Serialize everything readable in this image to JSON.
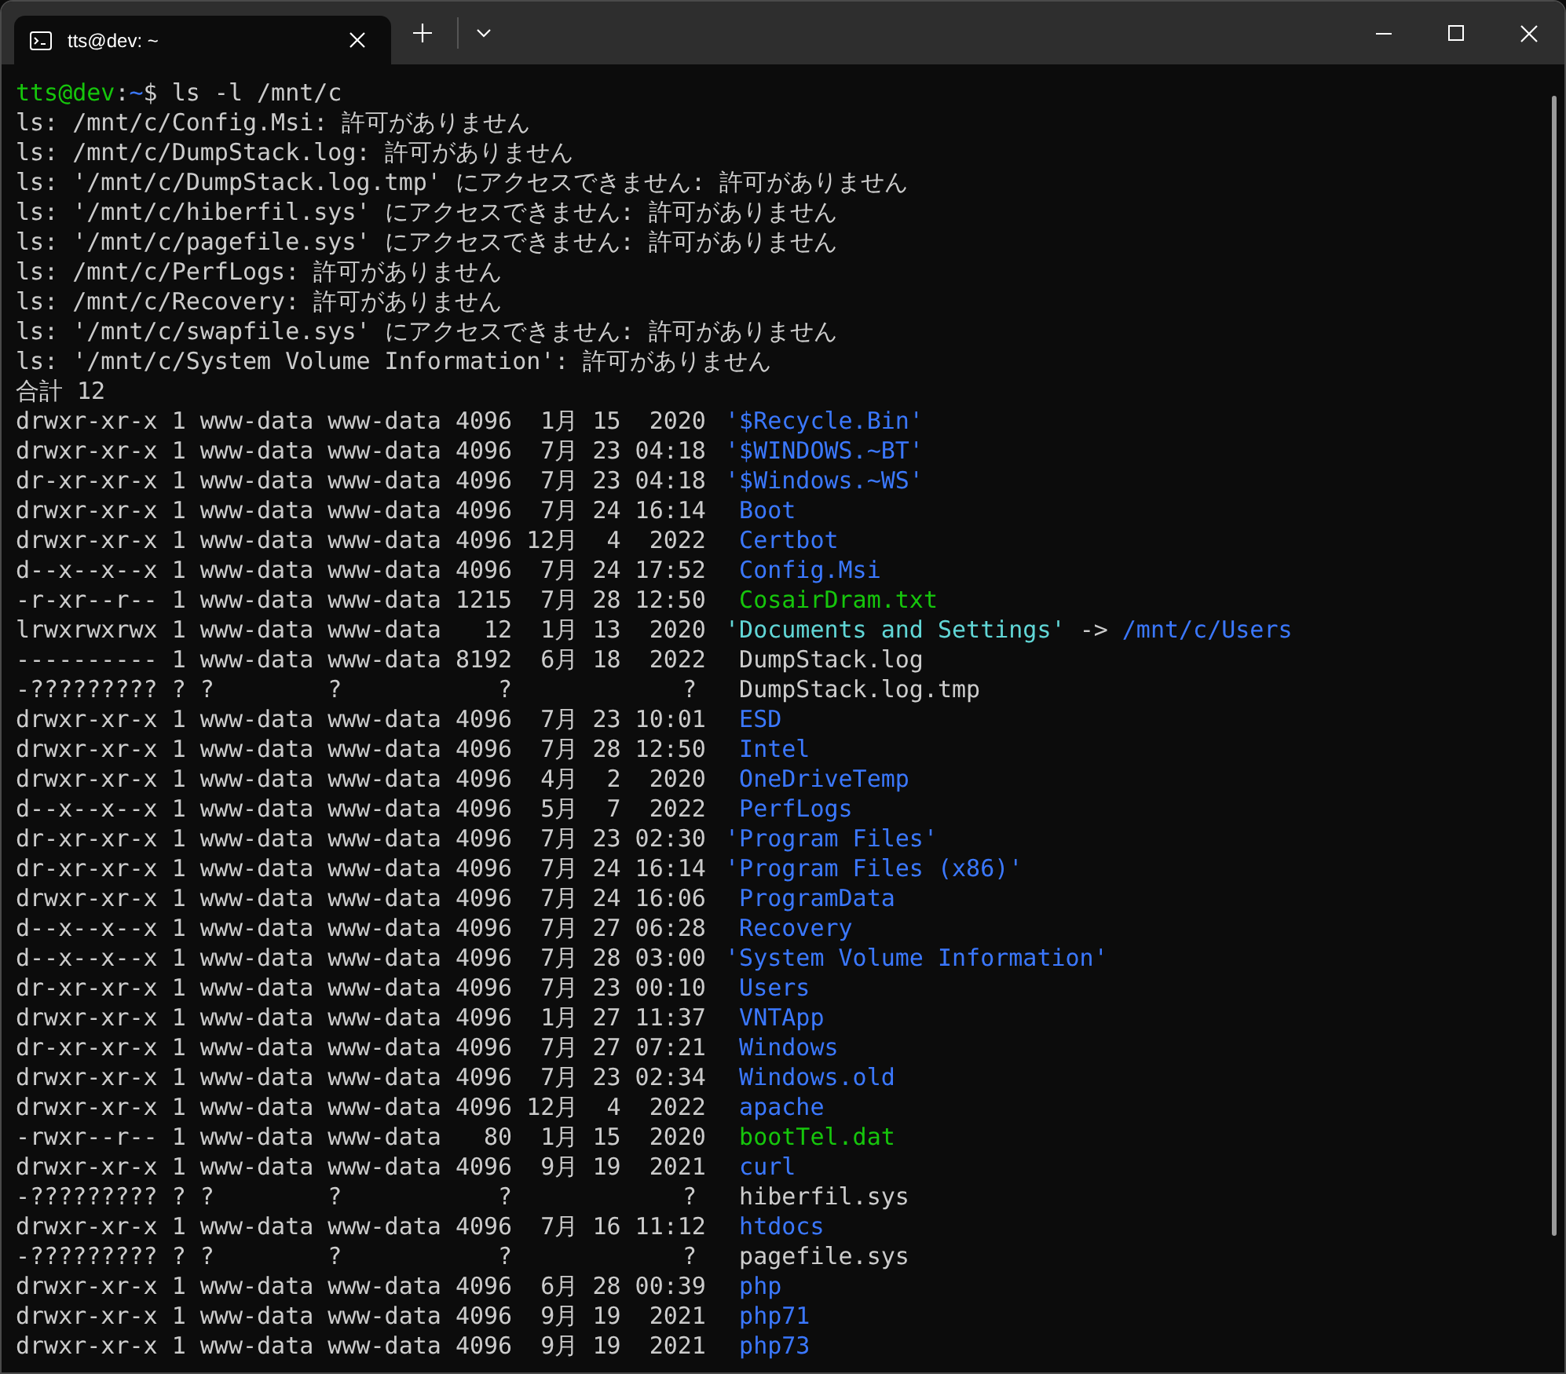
{
  "window": {
    "tab_title": "tts@dev: ~"
  },
  "prompt": {
    "user": "tts@dev",
    "separator": ":",
    "path": "~",
    "symbol": "$",
    "command": "ls -l /mnt/c"
  },
  "errors": [
    "ls: /mnt/c/Config.Msi: 許可がありません",
    "ls: /mnt/c/DumpStack.log: 許可がありません",
    "ls: '/mnt/c/DumpStack.log.tmp' にアクセスできません: 許可がありません",
    "ls: '/mnt/c/hiberfil.sys' にアクセスできません: 許可がありません",
    "ls: '/mnt/c/pagefile.sys' にアクセスできません: 許可がありません",
    "ls: /mnt/c/PerfLogs: 許可がありません",
    "ls: /mnt/c/Recovery: 許可がありません",
    "ls: '/mnt/c/swapfile.sys' にアクセスできません: 許可がありません",
    "ls: '/mnt/c/System Volume Information': 許可がありません"
  ],
  "total": "合計 12",
  "entries": [
    {
      "meta": "drwxr-xr-x 1 www-data www-data 4096  1月 15  2020",
      "name": "'$Recycle.Bin'",
      "kind": "dir",
      "quoted": true
    },
    {
      "meta": "drwxr-xr-x 1 www-data www-data 4096  7月 23 04:18",
      "name": "'$WINDOWS.~BT'",
      "kind": "dir",
      "quoted": true
    },
    {
      "meta": "dr-xr-xr-x 1 www-data www-data 4096  7月 23 04:18",
      "name": "'$Windows.~WS'",
      "kind": "dir",
      "quoted": true
    },
    {
      "meta": "drwxr-xr-x 1 www-data www-data 4096  7月 24 16:14",
      "name": "Boot",
      "kind": "dir",
      "quoted": false
    },
    {
      "meta": "drwxr-xr-x 1 www-data www-data 4096 12月  4  2022",
      "name": "Certbot",
      "kind": "dir",
      "quoted": false
    },
    {
      "meta": "d--x--x--x 1 www-data www-data 4096  7月 24 17:52",
      "name": "Config.Msi",
      "kind": "dir",
      "quoted": false
    },
    {
      "meta": "-r-xr--r-- 1 www-data www-data 1215  7月 28 12:50",
      "name": "CosairDram.txt",
      "kind": "exec",
      "quoted": false
    },
    {
      "meta": "lrwxrwxrwx 1 www-data www-data   12  1月 13  2020",
      "name": "'Documents and Settings'",
      "kind": "link",
      "quoted": true,
      "arrow": "->",
      "target": "/mnt/c/Users"
    },
    {
      "meta": "---------- 1 www-data www-data 8192  6月 18  2022",
      "name": "DumpStack.log",
      "kind": "file",
      "quoted": false
    },
    {
      "meta": "-????????? ? ?        ?           ?            ?",
      "name": "DumpStack.log.tmp",
      "kind": "file",
      "quoted": false
    },
    {
      "meta": "drwxr-xr-x 1 www-data www-data 4096  7月 23 10:01",
      "name": "ESD",
      "kind": "dir",
      "quoted": false
    },
    {
      "meta": "drwxr-xr-x 1 www-data www-data 4096  7月 28 12:50",
      "name": "Intel",
      "kind": "dir",
      "quoted": false
    },
    {
      "meta": "drwxr-xr-x 1 www-data www-data 4096  4月  2  2020",
      "name": "OneDriveTemp",
      "kind": "dir",
      "quoted": false
    },
    {
      "meta": "d--x--x--x 1 www-data www-data 4096  5月  7  2022",
      "name": "PerfLogs",
      "kind": "dir",
      "quoted": false
    },
    {
      "meta": "dr-xr-xr-x 1 www-data www-data 4096  7月 23 02:30",
      "name": "'Program Files'",
      "kind": "dir",
      "quoted": true
    },
    {
      "meta": "dr-xr-xr-x 1 www-data www-data 4096  7月 24 16:14",
      "name": "'Program Files (x86)'",
      "kind": "dir",
      "quoted": true
    },
    {
      "meta": "drwxr-xr-x 1 www-data www-data 4096  7月 24 16:06",
      "name": "ProgramData",
      "kind": "dir",
      "quoted": false
    },
    {
      "meta": "d--x--x--x 1 www-data www-data 4096  7月 27 06:28",
      "name": "Recovery",
      "kind": "dir",
      "quoted": false
    },
    {
      "meta": "d--x--x--x 1 www-data www-data 4096  7月 28 03:00",
      "name": "'System Volume Information'",
      "kind": "dir",
      "quoted": true
    },
    {
      "meta": "dr-xr-xr-x 1 www-data www-data 4096  7月 23 00:10",
      "name": "Users",
      "kind": "dir",
      "quoted": false
    },
    {
      "meta": "drwxr-xr-x 1 www-data www-data 4096  1月 27 11:37",
      "name": "VNTApp",
      "kind": "dir",
      "quoted": false
    },
    {
      "meta": "dr-xr-xr-x 1 www-data www-data 4096  7月 27 07:21",
      "name": "Windows",
      "kind": "dir",
      "quoted": false
    },
    {
      "meta": "drwxr-xr-x 1 www-data www-data 4096  7月 23 02:34",
      "name": "Windows.old",
      "kind": "dir",
      "quoted": false
    },
    {
      "meta": "drwxr-xr-x 1 www-data www-data 4096 12月  4  2022",
      "name": "apache",
      "kind": "dir",
      "quoted": false
    },
    {
      "meta": "-rwxr--r-- 1 www-data www-data   80  1月 15  2020",
      "name": "bootTel.dat",
      "kind": "exec",
      "quoted": false
    },
    {
      "meta": "drwxr-xr-x 1 www-data www-data 4096  9月 19  2021",
      "name": "curl",
      "kind": "dir",
      "quoted": false
    },
    {
      "meta": "-????????? ? ?        ?           ?            ?",
      "name": "hiberfil.sys",
      "kind": "file",
      "quoted": false
    },
    {
      "meta": "drwxr-xr-x 1 www-data www-data 4096  7月 16 11:12",
      "name": "htdocs",
      "kind": "dir",
      "quoted": false
    },
    {
      "meta": "-????????? ? ?        ?           ?            ?",
      "name": "pagefile.sys",
      "kind": "file",
      "quoted": false
    },
    {
      "meta": "drwxr-xr-x 1 www-data www-data 4096  6月 28 00:39",
      "name": "php",
      "kind": "dir",
      "quoted": false
    },
    {
      "meta": "drwxr-xr-x 1 www-data www-data 4096  9月 19  2021",
      "name": "php71",
      "kind": "dir",
      "quoted": false
    },
    {
      "meta": "drwxr-xr-x 1 www-data www-data 4096  9月 19  2021",
      "name": "php73",
      "kind": "dir",
      "quoted": false
    }
  ]
}
